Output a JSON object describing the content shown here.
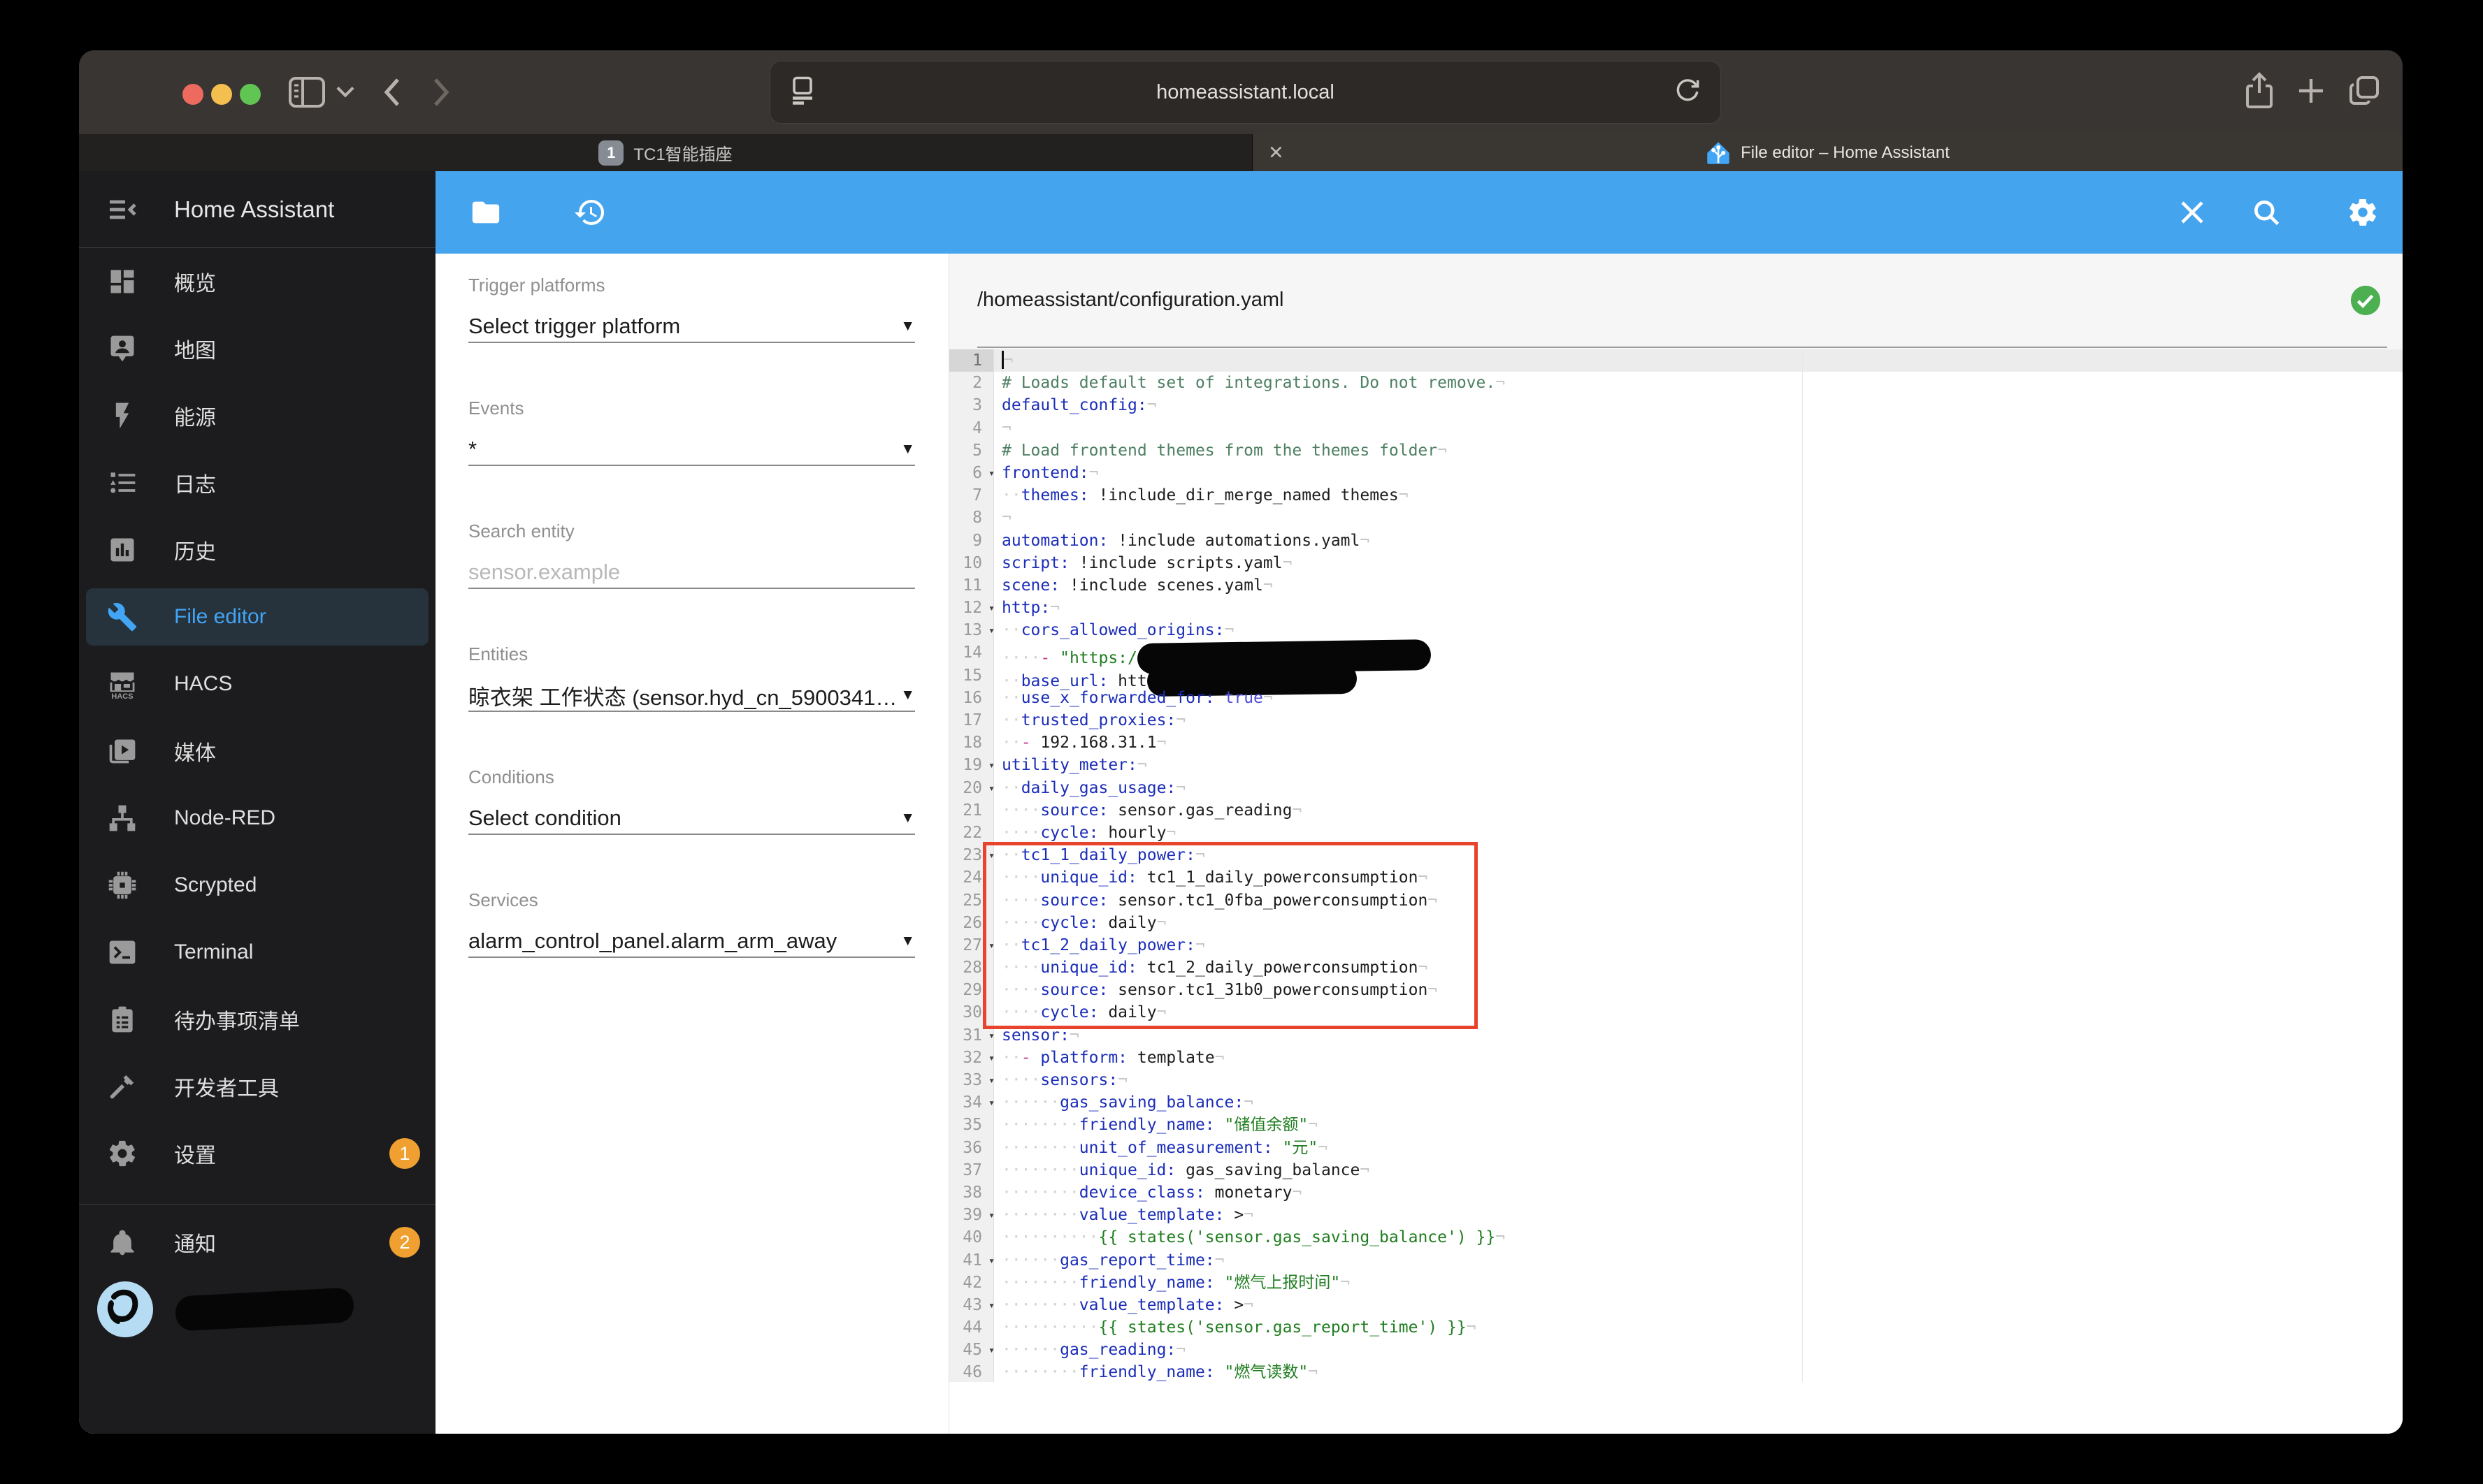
{
  "theme": {
    "accent": "#45a4ee",
    "selected": "#42a5f5",
    "badge": "#f0a030",
    "fab": "#ee584e",
    "ok_green": "#4caf50",
    "annotation": "#e8432c"
  },
  "browser": {
    "url": "homeassistant.local",
    "tabs": [
      {
        "badge": "1",
        "title": "TC1智能插座",
        "active": false
      },
      {
        "title": "File editor – Home Assistant",
        "active": true
      }
    ]
  },
  "sidebar": {
    "title": "Home Assistant",
    "items": [
      {
        "id": "overview",
        "label": "概览",
        "icon": "dashboard-icon"
      },
      {
        "id": "map",
        "label": "地图",
        "icon": "map-person-icon"
      },
      {
        "id": "energy",
        "label": "能源",
        "icon": "lightning-icon"
      },
      {
        "id": "logbook",
        "label": "日志",
        "icon": "list-icon"
      },
      {
        "id": "history",
        "label": "历史",
        "icon": "chart-icon"
      },
      {
        "id": "file-editor",
        "label": "File editor",
        "icon": "wrench-icon",
        "selected": true
      },
      {
        "id": "hacs",
        "label": "HACS",
        "icon": "hacs-store-icon"
      },
      {
        "id": "media",
        "label": "媒体",
        "icon": "media-icon"
      },
      {
        "id": "node-red",
        "label": "Node-RED",
        "icon": "sitemap-icon"
      },
      {
        "id": "scrypted",
        "label": "Scrypted",
        "icon": "chip-icon"
      },
      {
        "id": "terminal",
        "label": "Terminal",
        "icon": "terminal-icon"
      },
      {
        "id": "todo-list",
        "label": "待办事项清单",
        "icon": "clipboard-icon"
      },
      {
        "id": "developer-tools",
        "label": "开发者工具",
        "icon": "hammer-icon"
      },
      {
        "id": "settings",
        "label": "设置",
        "icon": "gear-icon",
        "badge": "1"
      }
    ],
    "notifications": {
      "label": "通知",
      "icon": "bell-icon",
      "badge": "2"
    }
  },
  "panel": {
    "fields": [
      {
        "id": "trigger-platforms",
        "label": "Trigger platforms",
        "value": "Select trigger platform",
        "dropdown": true
      },
      {
        "id": "events",
        "label": "Events",
        "value": "*",
        "dropdown": true
      },
      {
        "id": "search-entity",
        "label": "Search entity",
        "placeholder": "sensor.example",
        "dropdown": false
      },
      {
        "id": "entities",
        "label": "Entities",
        "value": "晾衣架 工作状态 (sensor.hyd_cn_5900341…",
        "dropdown": true
      },
      {
        "id": "conditions",
        "label": "Conditions",
        "value": "Select condition",
        "dropdown": true
      },
      {
        "id": "services",
        "label": "Services",
        "value": "alarm_control_panel.alarm_arm_away",
        "dropdown": true
      }
    ]
  },
  "editor": {
    "path": "/homeassistant/configuration.yaml",
    "saved_ok": true,
    "annotation": {
      "line_start": 23,
      "line_end": 30
    },
    "lines": [
      {
        "n": 1,
        "active": true,
        "cursor": true,
        "seg": [
          [
            "e",
            "¬"
          ]
        ]
      },
      {
        "n": 2,
        "seg": [
          [
            "c",
            "# Loads default set of integrations. Do not remove."
          ],
          [
            "e",
            "¬"
          ]
        ]
      },
      {
        "n": 3,
        "seg": [
          [
            "k",
            "default_config:"
          ],
          [
            "e",
            "¬"
          ]
        ]
      },
      {
        "n": 4,
        "seg": [
          [
            "e",
            "¬"
          ]
        ]
      },
      {
        "n": 5,
        "seg": [
          [
            "c",
            "# Load frontend themes from the themes folder"
          ],
          [
            "e",
            "¬"
          ]
        ]
      },
      {
        "n": 6,
        "fold": true,
        "seg": [
          [
            "k",
            "frontend:"
          ],
          [
            "e",
            "¬"
          ]
        ]
      },
      {
        "n": 7,
        "seg": [
          [
            "w",
            "··"
          ],
          [
            "k",
            "themes:"
          ],
          [
            "v",
            " !include_dir_merge_named themes"
          ],
          [
            "e",
            "¬"
          ]
        ]
      },
      {
        "n": 8,
        "seg": [
          [
            "e",
            "¬"
          ]
        ]
      },
      {
        "n": 9,
        "seg": [
          [
            "k",
            "automation:"
          ],
          [
            "v",
            " !include automations.yaml"
          ],
          [
            "e",
            "¬"
          ]
        ]
      },
      {
        "n": 10,
        "seg": [
          [
            "k",
            "script:"
          ],
          [
            "v",
            " !include scripts.yaml"
          ],
          [
            "e",
            "¬"
          ]
        ]
      },
      {
        "n": 11,
        "seg": [
          [
            "k",
            "scene:"
          ],
          [
            "v",
            " !include scenes.yaml"
          ],
          [
            "e",
            "¬"
          ]
        ]
      },
      {
        "n": 12,
        "fold": true,
        "seg": [
          [
            "k",
            "http:"
          ],
          [
            "e",
            "¬"
          ]
        ]
      },
      {
        "n": 13,
        "fold": true,
        "seg": [
          [
            "w",
            "··"
          ],
          [
            "k",
            "cors_allowed_origins:"
          ],
          [
            "e",
            "¬"
          ]
        ]
      },
      {
        "n": 14,
        "seg": [
          [
            "w",
            "····"
          ],
          [
            "d",
            "-"
          ],
          [
            "s",
            " \"https:/"
          ],
          [
            "x",
            420
          ]
        ]
      },
      {
        "n": 15,
        "seg": [
          [
            "w",
            "··"
          ],
          [
            "k",
            "base_url:"
          ],
          [
            "v",
            " htt"
          ],
          [
            "x",
            300
          ]
        ]
      },
      {
        "n": 16,
        "seg": [
          [
            "w",
            "··"
          ],
          [
            "k",
            "use_x_forwarded_for:"
          ],
          [
            "b",
            " true"
          ],
          [
            "e",
            "¬"
          ]
        ]
      },
      {
        "n": 17,
        "seg": [
          [
            "w",
            "··"
          ],
          [
            "k",
            "trusted_proxies:"
          ],
          [
            "e",
            "¬"
          ]
        ]
      },
      {
        "n": 18,
        "seg": [
          [
            "w",
            "··"
          ],
          [
            "d",
            "-"
          ],
          [
            "v",
            " 192.168.31.1"
          ],
          [
            "e",
            "¬"
          ]
        ]
      },
      {
        "n": 19,
        "fold": true,
        "seg": [
          [
            "k",
            "utility_meter:"
          ],
          [
            "e",
            "¬"
          ]
        ]
      },
      {
        "n": 20,
        "fold": true,
        "seg": [
          [
            "w",
            "··"
          ],
          [
            "k",
            "daily_gas_usage:"
          ],
          [
            "e",
            "¬"
          ]
        ]
      },
      {
        "n": 21,
        "seg": [
          [
            "w",
            "····"
          ],
          [
            "k",
            "source:"
          ],
          [
            "v",
            " sensor.gas_reading"
          ],
          [
            "e",
            "¬"
          ]
        ]
      },
      {
        "n": 22,
        "seg": [
          [
            "w",
            "····"
          ],
          [
            "k",
            "cycle:"
          ],
          [
            "v",
            " hourly"
          ],
          [
            "e",
            "¬"
          ]
        ]
      },
      {
        "n": 23,
        "fold": true,
        "seg": [
          [
            "w",
            "··"
          ],
          [
            "k",
            "tc1_1_daily_power:"
          ],
          [
            "e",
            "¬"
          ]
        ]
      },
      {
        "n": 24,
        "seg": [
          [
            "w",
            "····"
          ],
          [
            "k",
            "unique_id:"
          ],
          [
            "v",
            " tc1_1_daily_powerconsumption"
          ],
          [
            "e",
            "¬"
          ]
        ]
      },
      {
        "n": 25,
        "seg": [
          [
            "w",
            "····"
          ],
          [
            "k",
            "source:"
          ],
          [
            "v",
            " sensor.tc1_0fba_powerconsumption"
          ],
          [
            "e",
            "¬"
          ]
        ]
      },
      {
        "n": 26,
        "seg": [
          [
            "w",
            "····"
          ],
          [
            "k",
            "cycle:"
          ],
          [
            "v",
            " daily"
          ],
          [
            "e",
            "¬"
          ]
        ]
      },
      {
        "n": 27,
        "fold": true,
        "seg": [
          [
            "w",
            "··"
          ],
          [
            "k",
            "tc1_2_daily_power:"
          ],
          [
            "e",
            "¬"
          ]
        ]
      },
      {
        "n": 28,
        "seg": [
          [
            "w",
            "····"
          ],
          [
            "k",
            "unique_id:"
          ],
          [
            "v",
            " tc1_2_daily_powerconsumption"
          ],
          [
            "e",
            "¬"
          ]
        ]
      },
      {
        "n": 29,
        "seg": [
          [
            "w",
            "····"
          ],
          [
            "k",
            "source:"
          ],
          [
            "v",
            " sensor.tc1_31b0_powerconsumption"
          ],
          [
            "e",
            "¬"
          ]
        ]
      },
      {
        "n": 30,
        "seg": [
          [
            "w",
            "····"
          ],
          [
            "k",
            "cycle:"
          ],
          [
            "v",
            " daily"
          ],
          [
            "e",
            "¬"
          ]
        ]
      },
      {
        "n": 31,
        "fold": true,
        "seg": [
          [
            "k",
            "sensor:"
          ],
          [
            "e",
            "¬"
          ]
        ]
      },
      {
        "n": 32,
        "fold": true,
        "seg": [
          [
            "w",
            "··"
          ],
          [
            "d",
            "-"
          ],
          [
            "k",
            " platform:"
          ],
          [
            "v",
            " template"
          ],
          [
            "e",
            "¬"
          ]
        ]
      },
      {
        "n": 33,
        "fold": true,
        "seg": [
          [
            "w",
            "····"
          ],
          [
            "k",
            "sensors:"
          ],
          [
            "e",
            "¬"
          ]
        ]
      },
      {
        "n": 34,
        "fold": true,
        "seg": [
          [
            "w",
            "······"
          ],
          [
            "k",
            "gas_saving_balance:"
          ],
          [
            "e",
            "¬"
          ]
        ]
      },
      {
        "n": 35,
        "seg": [
          [
            "w",
            "········"
          ],
          [
            "k",
            "friendly_name:"
          ],
          [
            "s",
            " \"储值余额\""
          ],
          [
            "e",
            "¬"
          ]
        ]
      },
      {
        "n": 36,
        "seg": [
          [
            "w",
            "········"
          ],
          [
            "k",
            "unit_of_measurement:"
          ],
          [
            "s",
            " \"元\""
          ],
          [
            "e",
            "¬"
          ]
        ]
      },
      {
        "n": 37,
        "seg": [
          [
            "w",
            "········"
          ],
          [
            "k",
            "unique_id:"
          ],
          [
            "v",
            " gas_saving_balance"
          ],
          [
            "e",
            "¬"
          ]
        ]
      },
      {
        "n": 38,
        "seg": [
          [
            "w",
            "········"
          ],
          [
            "k",
            "device_class:"
          ],
          [
            "v",
            " monetary"
          ],
          [
            "e",
            "¬"
          ]
        ]
      },
      {
        "n": 39,
        "fold": true,
        "seg": [
          [
            "w",
            "········"
          ],
          [
            "k",
            "value_template:"
          ],
          [
            "v",
            " >"
          ],
          [
            "e",
            "¬"
          ]
        ]
      },
      {
        "n": 40,
        "seg": [
          [
            "w",
            "··········"
          ],
          [
            "s",
            "{{ states('sensor.gas_saving_balance') }}"
          ],
          [
            "e",
            "¬"
          ]
        ]
      },
      {
        "n": 41,
        "fold": true,
        "seg": [
          [
            "w",
            "······"
          ],
          [
            "k",
            "gas_report_time:"
          ],
          [
            "e",
            "¬"
          ]
        ]
      },
      {
        "n": 42,
        "seg": [
          [
            "w",
            "········"
          ],
          [
            "k",
            "friendly_name:"
          ],
          [
            "s",
            " \"燃气上报时间\""
          ],
          [
            "e",
            "¬"
          ]
        ]
      },
      {
        "n": 43,
        "fold": true,
        "seg": [
          [
            "w",
            "········"
          ],
          [
            "k",
            "value_template:"
          ],
          [
            "v",
            " >"
          ],
          [
            "e",
            "¬"
          ]
        ]
      },
      {
        "n": 44,
        "seg": [
          [
            "w",
            "··········"
          ],
          [
            "s",
            "{{ states('sensor.gas_report_time') }}"
          ],
          [
            "e",
            "¬"
          ]
        ]
      },
      {
        "n": 45,
        "fold": true,
        "seg": [
          [
            "w",
            "······"
          ],
          [
            "k",
            "gas_reading:"
          ],
          [
            "e",
            "¬"
          ]
        ]
      },
      {
        "n": 46,
        "seg": [
          [
            "w",
            "········"
          ],
          [
            "k",
            "friendly_name:"
          ],
          [
            "s",
            " \"燃气读数\""
          ],
          [
            "e",
            "¬"
          ]
        ]
      }
    ]
  }
}
